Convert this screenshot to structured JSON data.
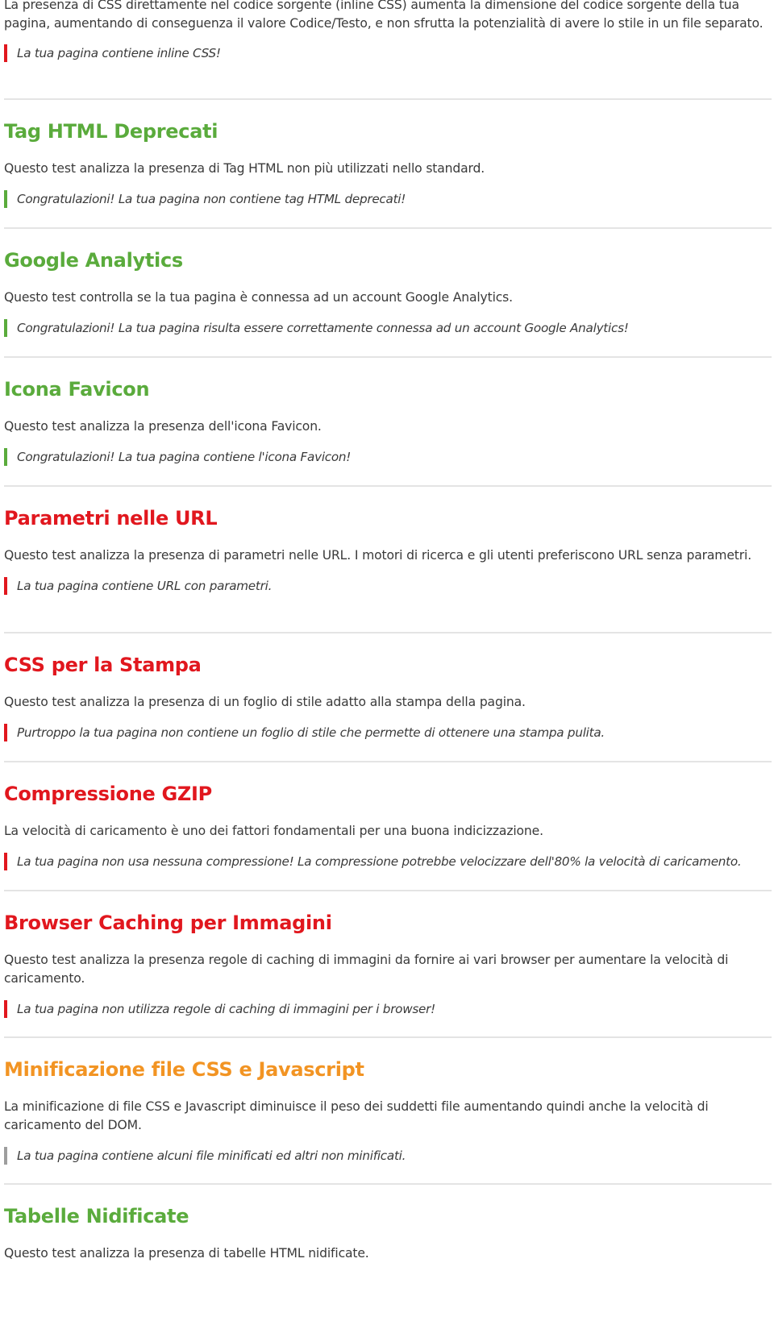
{
  "intro": {
    "description": "La presenza di CSS direttamente nel codice sorgente (inline CSS) aumenta la dimensione del codice sorgente della tua pagina, aumentando di conseguenza il valore Codice/Testo, e non sfrutta la potenzialità di avere lo stile in un file separato.",
    "result": "La tua pagina contiene inline CSS!",
    "status": "fail"
  },
  "sections": [
    {
      "title": "Tag HTML Deprecati",
      "status": "pass",
      "description": "Questo test analizza la presenza di Tag HTML non più utilizzati nello standard.",
      "result": "Congratulazioni! La tua pagina non contiene tag HTML deprecati!"
    },
    {
      "title": "Google Analytics",
      "status": "pass",
      "description": "Questo test controlla se la tua pagina è connessa ad un account Google Analytics.",
      "result": "Congratulazioni! La tua pagina risulta essere correttamente connessa ad un account Google Analytics!"
    },
    {
      "title": "Icona Favicon",
      "status": "pass",
      "description": "Questo test analizza la presenza dell'icona Favicon.",
      "result": "Congratulazioni! La tua pagina contiene l'icona Favicon!"
    },
    {
      "title": "Parametri nelle URL",
      "status": "fail",
      "description": "Questo test analizza la presenza di parametri nelle URL. I motori di ricerca e gli utenti preferiscono URL senza parametri.",
      "result": "La tua pagina contiene URL con parametri."
    },
    {
      "title": "CSS per la Stampa",
      "status": "fail",
      "description": "Questo test analizza la presenza di un foglio di stile adatto alla stampa della pagina.",
      "result": "Purtroppo la tua pagina non contiene un foglio di stile che permette di ottenere una stampa pulita."
    },
    {
      "title": "Compressione GZIP",
      "status": "fail",
      "description": "La velocità di caricamento è uno dei fattori fondamentali per una buona indicizzazione.",
      "result": "La tua pagina non usa nessuna compressione! La compressione potrebbe velocizzare dell'80% la velocità di caricamento."
    },
    {
      "title": "Browser Caching per Immagini",
      "status": "fail",
      "description": "Questo test analizza la presenza regole di caching di immagini da fornire ai vari browser per aumentare la velocità di caricamento.",
      "result": "La tua pagina non utilizza regole di caching di immagini per i browser!"
    },
    {
      "title": "Minificazione file CSS e Javascript",
      "status": "warning",
      "description": "La minificazione di file CSS e Javascript diminuisce il peso dei suddetti file aumentando quindi anche la velocità di caricamento del DOM.",
      "result": "La tua pagina contiene alcuni file minificati ed altri non minificati."
    },
    {
      "title": "Tabelle Nidificate",
      "status": "pass",
      "description": "Questo test analizza la presenza di tabelle HTML nidificate.",
      "result": ""
    }
  ],
  "colors": {
    "pass": "#5aab3c",
    "fail": "#e1171e",
    "warning_title": "#f29423",
    "warning_bar": "#9e9e9e",
    "divider": "#e4e4e4",
    "text": "#3a3a3a"
  }
}
